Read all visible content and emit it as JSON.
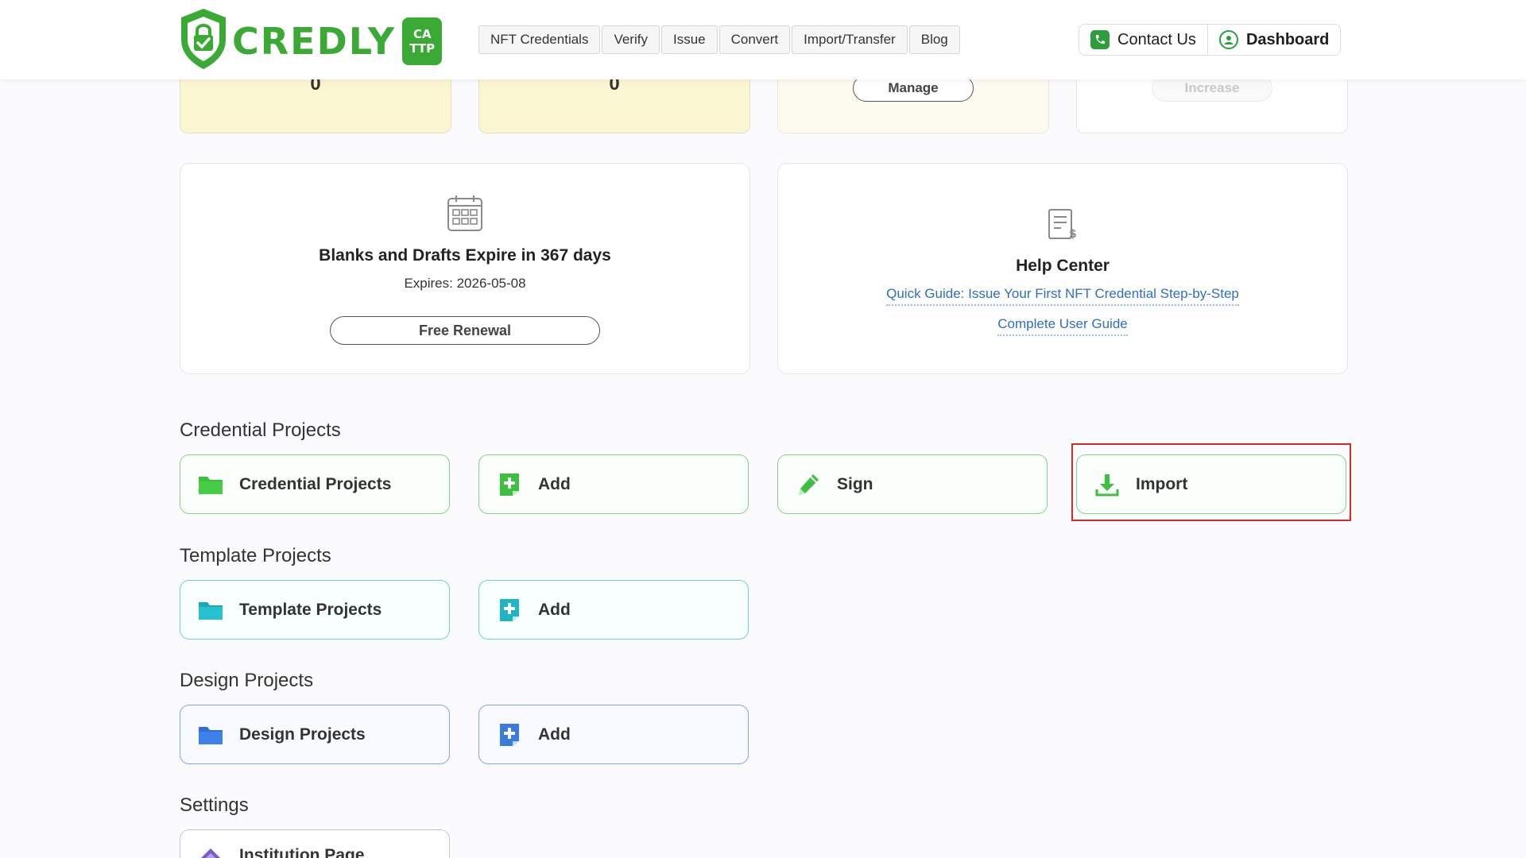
{
  "header": {
    "logo": {
      "text": "CREDLY",
      "badge_line1": "CA",
      "badge_line2": "TTP"
    },
    "nav": [
      "NFT Credentials",
      "Verify",
      "Issue",
      "Convert",
      "Import/Transfer",
      "Blog"
    ],
    "contact_label": "Contact Us",
    "dashboard_label": "Dashboard"
  },
  "stats": {
    "card1_value": "0",
    "card2_value": "0",
    "manage_label": "Manage",
    "increase_label": "Increase"
  },
  "expiry_card": {
    "title": "Blanks and Drafts Expire in 367 days",
    "expires": "Expires: 2026-05-08",
    "renew_label": "Free Renewal"
  },
  "help_card": {
    "title": "Help Center",
    "link1": "Quick Guide: Issue Your First NFT Credential Step-by-Step",
    "link2": "Complete User Guide"
  },
  "credential_projects": {
    "title": "Credential Projects",
    "tiles": [
      "Credential Projects",
      "Add",
      "Sign",
      "Import"
    ]
  },
  "template_projects": {
    "title": "Template Projects",
    "tiles": [
      "Template Projects",
      "Add"
    ]
  },
  "design_projects": {
    "title": "Design Projects",
    "tiles": [
      "Design Projects",
      "Add"
    ]
  },
  "settings": {
    "title": "Settings",
    "tiles": [
      "Institution Page"
    ]
  },
  "colors": {
    "brand_green": "#3aaa35",
    "highlight_red": "#d62a2a",
    "link_blue": "#2f6fbf"
  },
  "icons": {
    "logo": "shield-check-icon",
    "contact": "phone-icon",
    "dashboard": "user-icon",
    "calendar": "calendar-icon",
    "help": "document-icon",
    "folder": "folder-icon",
    "add": "add-document-icon",
    "sign": "pencil-icon",
    "import": "download-icon",
    "institution": "diamond-icon"
  }
}
